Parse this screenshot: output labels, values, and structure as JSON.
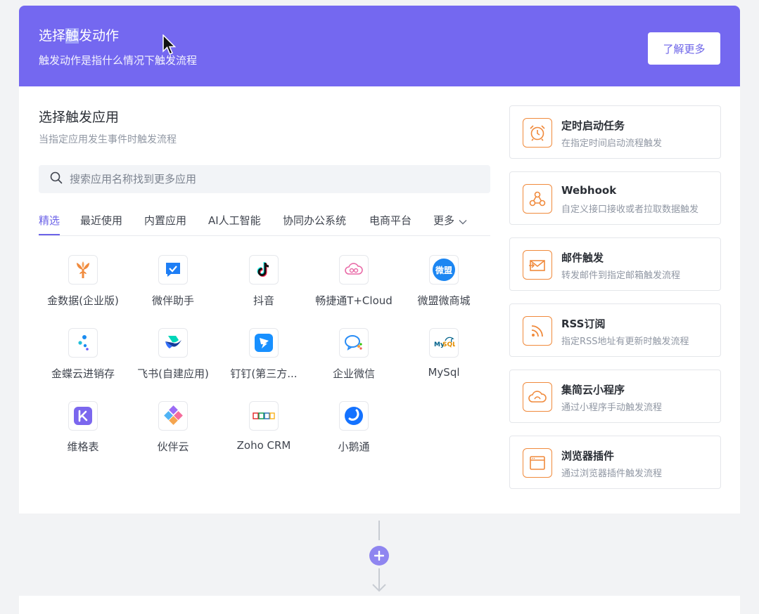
{
  "header": {
    "title_prefix": "选择",
    "title_highlight": "触",
    "title_suffix": "发动作",
    "subtitle": "触发动作是指什么情况下触发流程",
    "learn_more": "了解更多",
    "color": "#7468f0"
  },
  "apps_section": {
    "title": "选择触发应用",
    "subtitle": "当指定应用发生事件时触发流程",
    "search_placeholder": "搜索应用名称找到更多应用"
  },
  "tabs": [
    {
      "label": "精选",
      "active": true
    },
    {
      "label": "最近使用"
    },
    {
      "label": "内置应用"
    },
    {
      "label": "AI人工智能"
    },
    {
      "label": "协同办公系统"
    },
    {
      "label": "电商平台"
    },
    {
      "label": "更多"
    }
  ],
  "apps": [
    {
      "name": "金数据(企业版)",
      "icon": "jinshuju-tree-icon"
    },
    {
      "name": "微伴助手",
      "icon": "weiban-check-icon"
    },
    {
      "name": "抖音",
      "icon": "douyin-note-icon"
    },
    {
      "name": "畅捷通T+Cloud",
      "icon": "chanjet-cloud-icon"
    },
    {
      "name": "微盟微商城",
      "icon": "weimob-icon"
    },
    {
      "name": "金蝶云进销存",
      "icon": "kingdee-dots-icon"
    },
    {
      "name": "飞书(自建应用)",
      "icon": "feishu-bird-icon"
    },
    {
      "name": "钉钉(第三方...",
      "icon": "dingtalk-wing-icon"
    },
    {
      "name": "企业微信",
      "icon": "wecom-bubble-icon"
    },
    {
      "name": "MySql",
      "icon": "mysql-dolphin-icon"
    },
    {
      "name": "维格表",
      "icon": "vika-icon"
    },
    {
      "name": "伙伴云",
      "icon": "huoban-diamond-icon"
    },
    {
      "name": "Zoho CRM",
      "icon": "zoho-logo-icon"
    },
    {
      "name": "小鹅通",
      "icon": "xiaoe-icon"
    }
  ],
  "triggers": [
    {
      "title": "定时启动任务",
      "subtitle": "在指定时间启动流程触发",
      "icon": "alarm-clock-icon"
    },
    {
      "title": "Webhook",
      "subtitle": "自定义接口接收或者拉取数据触发",
      "icon": "webhook-icon"
    },
    {
      "title": "邮件触发",
      "subtitle": "转发邮件到指定邮箱触发流程",
      "icon": "mail-icon"
    },
    {
      "title": "RSS订阅",
      "subtitle": "指定RSS地址有更新时触发流程",
      "icon": "rss-icon"
    },
    {
      "title": "集简云小程序",
      "subtitle": "通过小程序手动触发流程",
      "icon": "cloud-icon"
    },
    {
      "title": "浏览器插件",
      "subtitle": "通过浏览器插件触发流程",
      "icon": "browser-window-icon"
    }
  ],
  "colors": {
    "accent": "#6c63e8",
    "trigger_orange": "#f08a3c",
    "add_button": "#8f85f0"
  }
}
